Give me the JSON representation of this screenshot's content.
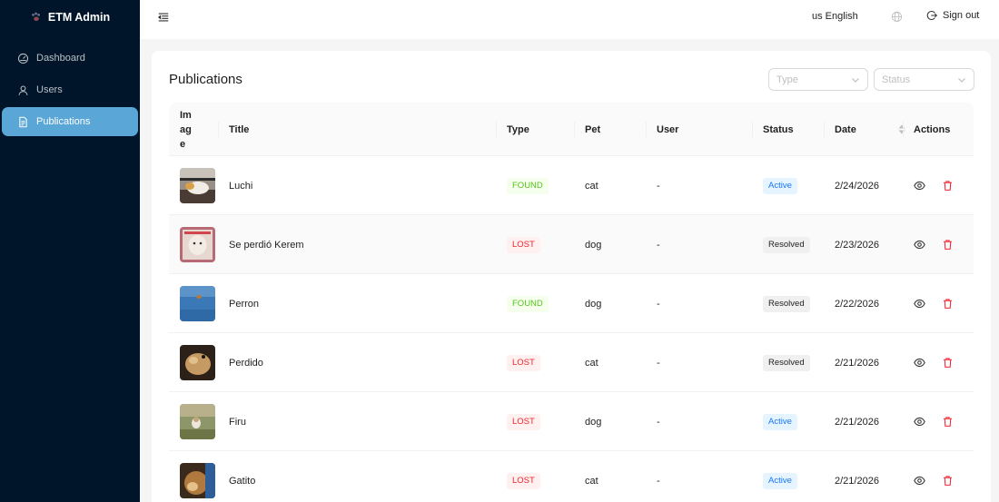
{
  "app": {
    "title": "ETM Admin"
  },
  "sidebar": {
    "items": [
      {
        "label": "Dashboard",
        "icon": "dashboard-icon",
        "active": false
      },
      {
        "label": "Users",
        "icon": "user-icon",
        "active": false
      },
      {
        "label": "Publications",
        "icon": "file-icon",
        "active": true
      }
    ]
  },
  "header": {
    "language": "us English",
    "signout_label": "Sign out"
  },
  "page": {
    "title": "Publications",
    "filters": {
      "type_placeholder": "Type",
      "status_placeholder": "Status"
    }
  },
  "table": {
    "columns": [
      "Image",
      "Title",
      "Type",
      "Pet",
      "User",
      "Status",
      "Date",
      "Actions"
    ],
    "rows": [
      {
        "title": "Luchi",
        "type": "FOUND",
        "pet": "cat",
        "user": "-",
        "status": "Active",
        "date": "2/24/2026"
      },
      {
        "title": "Se perdió Kerem",
        "type": "LOST",
        "pet": "dog",
        "user": "-",
        "status": "Resolved",
        "date": "2/23/2026"
      },
      {
        "title": "Perron",
        "type": "FOUND",
        "pet": "dog",
        "user": "-",
        "status": "Resolved",
        "date": "2/22/2026"
      },
      {
        "title": "Perdido",
        "type": "LOST",
        "pet": "cat",
        "user": "-",
        "status": "Resolved",
        "date": "2/21/2026"
      },
      {
        "title": "Firu",
        "type": "LOST",
        "pet": "dog",
        "user": "-",
        "status": "Active",
        "date": "2/21/2026"
      },
      {
        "title": "Gatito",
        "type": "LOST",
        "pet": "cat",
        "user": "-",
        "status": "Active",
        "date": "2/21/2026"
      }
    ]
  },
  "colors": {
    "sidebar_bg": "#001529",
    "active_item": "#5aa6d6",
    "found": "#52c41a",
    "lost": "#f5222d",
    "active": "#1677ff"
  }
}
